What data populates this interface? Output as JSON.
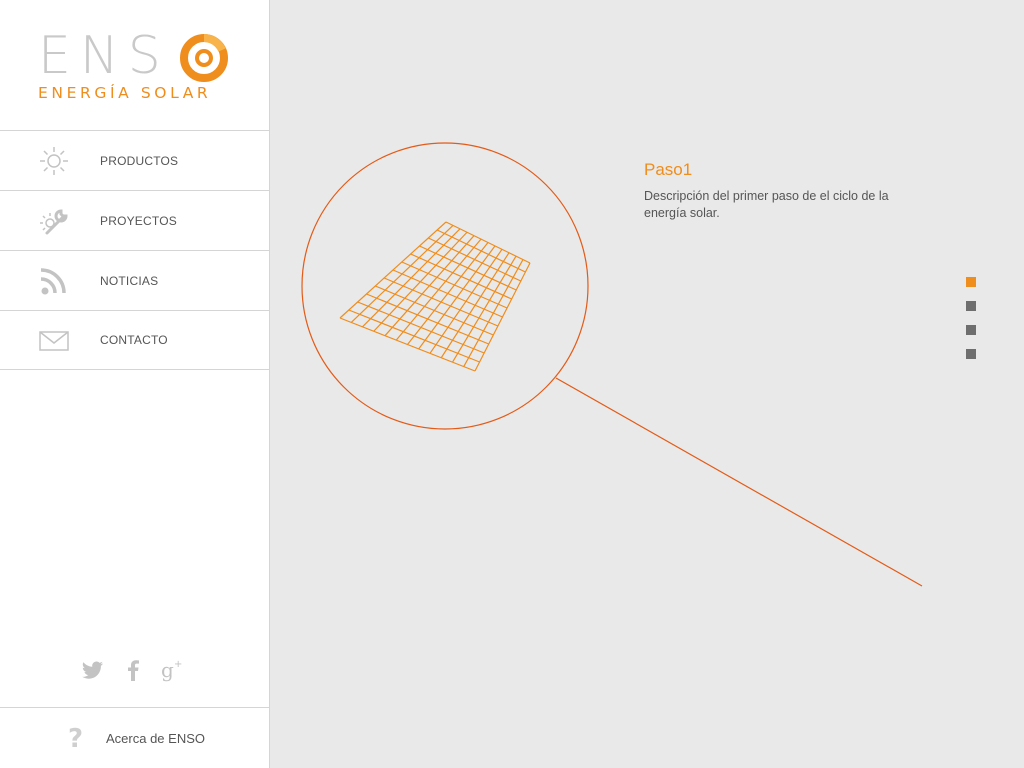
{
  "brand": {
    "name": "ENS",
    "tagline": "ENERGÍA SOLAR"
  },
  "nav": {
    "items": [
      {
        "label": "PRODUCTOS",
        "icon": "sun-icon"
      },
      {
        "label": "PROYECTOS",
        "icon": "tools-icon"
      },
      {
        "label": "NOTICIAS",
        "icon": "rss-icon"
      },
      {
        "label": "CONTACTO",
        "icon": "mail-icon"
      }
    ]
  },
  "social": {
    "items": [
      "twitter-icon",
      "facebook-icon",
      "google-plus-icon"
    ]
  },
  "about": {
    "label": "Acerca de ENSO"
  },
  "step": {
    "title": "Paso1",
    "description": "Descripción del primer paso de el ciclo de la energía solar."
  },
  "pager": {
    "total": 4,
    "active": 1
  },
  "colors": {
    "accent": "#ef8d1d",
    "line": "#e35b17",
    "text": "#555555",
    "muted": "#c3c3c3",
    "background": "#e9e9e9"
  }
}
